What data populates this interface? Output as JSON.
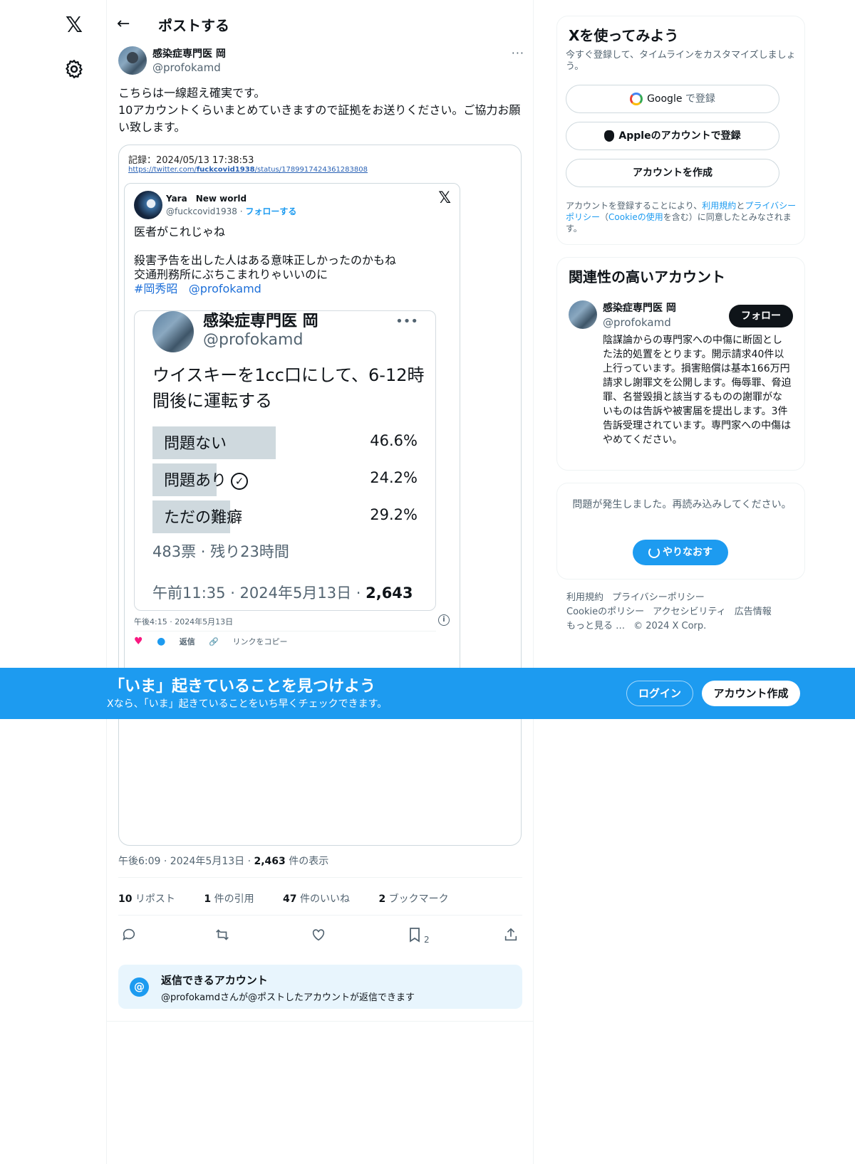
{
  "nav": {
    "logo": "𝕏"
  },
  "header": {
    "title": "ポストする",
    "back": "←"
  },
  "post": {
    "author_name": "感染症専門医 岡",
    "author_handle": "@profokamd",
    "more": "···",
    "text": "こちらは一線超え確実です。\n10アカウントくらいまとめていきますので証拠をお送りください。ご協力お願い致します。",
    "timestamp": "午後6:09 · 2024年5月13日 · ",
    "views_count": "2,463",
    "views_label": " 件の表示"
  },
  "media": {
    "record_line": "記録：2024/05/13 17:38:53",
    "record_url_prefix": "https://twitter.com/",
    "record_url_user": "fuckcovid1938",
    "record_url_suffix": "/status/1789917424361283808",
    "embed": {
      "name": "Yara　New world",
      "handle": "@fuckcovid1938 · ",
      "follow": "フォローする",
      "x": "𝕏",
      "line1": "医者がこれじゃね",
      "line2": "殺害予告を出した人はある意味正しかったのかもね",
      "line3": "交通刑務所にぶちこまれりゃいいのに",
      "tag1": "#岡秀昭",
      "tag2": "@profokamd",
      "timestamp": "午後4:15 · 2024年5月13日",
      "info": "i",
      "like": "♥",
      "reply": "返信",
      "copy": "リンクをコピー"
    },
    "poll": {
      "name": "感染症専門医 岡",
      "handle": "@profokamd",
      "more": "•••",
      "question": "ウイスキーを1cc口にして、6-12時間後に運転する",
      "options": [
        {
          "label": "問題ない",
          "pct": "46.6%",
          "value": 46.6
        },
        {
          "label": "問題あり",
          "pct": "24.2%",
          "value": 24.2,
          "check": "✓"
        },
        {
          "label": "ただの難癖",
          "pct": "29.2%",
          "value": 29.2
        }
      ],
      "meta": "483票 · 残り23時間",
      "time": "午前11:35 · 2024年5月13日 · ",
      "views": "2,643"
    }
  },
  "stats": {
    "reposts_n": "10",
    "reposts_l": " リポスト",
    "quotes_n": "1",
    "quotes_l": " 件の引用",
    "likes_n": "47",
    "likes_l": " 件のいいね",
    "bookmarks_n": "2",
    "bookmarks_l": " ブックマーク"
  },
  "actions": {
    "bookmark_count": "2"
  },
  "reply_box": {
    "icon": "@",
    "title": "返信できるアカウント",
    "sub": "@profokamdさんが@ポストしたアカウントが返信できます"
  },
  "signup": {
    "title": "Xを使ってみよう",
    "sub": "今すぐ登録して、タイムラインをカスタマイズしましょう。",
    "google_brand": "Google",
    "google_rest": " で登録",
    "apple": "Appleのアカウントで登録",
    "create": "アカウントを作成",
    "legal_1": "アカウントを登録することにより、",
    "legal_terms": "利用規約",
    "legal_2": "と",
    "legal_privacy": "プライバシーポリシー",
    "legal_3": "（",
    "legal_cookie": "Cookieの使用",
    "legal_4": "を含む）に同意したとみなされます。"
  },
  "related": {
    "title": "関連性の高いアカウント",
    "name": "感染症専門医 岡",
    "handle": "@profokamd",
    "follow": "フォロー",
    "bio": "陰謀論からの専門家への中傷に断固とした法的処置をとります。開示請求40件以上行っています。損害賠償は基本166万円請求し謝罪文を公開します。侮辱罪、脅迫罪、名誉毀損と該当するものの謝罪がないものは告訴や被害届を提出します。3件告訴受理されています。専門家への中傷はやめてください。"
  },
  "error": {
    "text": "問題が発生しました。再読み込みしてください。",
    "retry": "やりなおす"
  },
  "footer": {
    "terms": "利用規約",
    "privacy": "プライバシーポリシー",
    "cookie": "Cookieのポリシー",
    "accessibility": "アクセシビリティ",
    "ads": "広告情報",
    "more": "もっと見る …",
    "copyright": "© 2024 X Corp."
  },
  "banner": {
    "title": "「いま」起きていることを見つけよう",
    "sub": "Xなら、「いま」起きていることをいち早くチェックできます。",
    "login": "ログイン",
    "create": "アカウント作成"
  },
  "colors": {
    "accent": "#1d9bf0",
    "text": "#0f1419",
    "muted": "#536471"
  }
}
